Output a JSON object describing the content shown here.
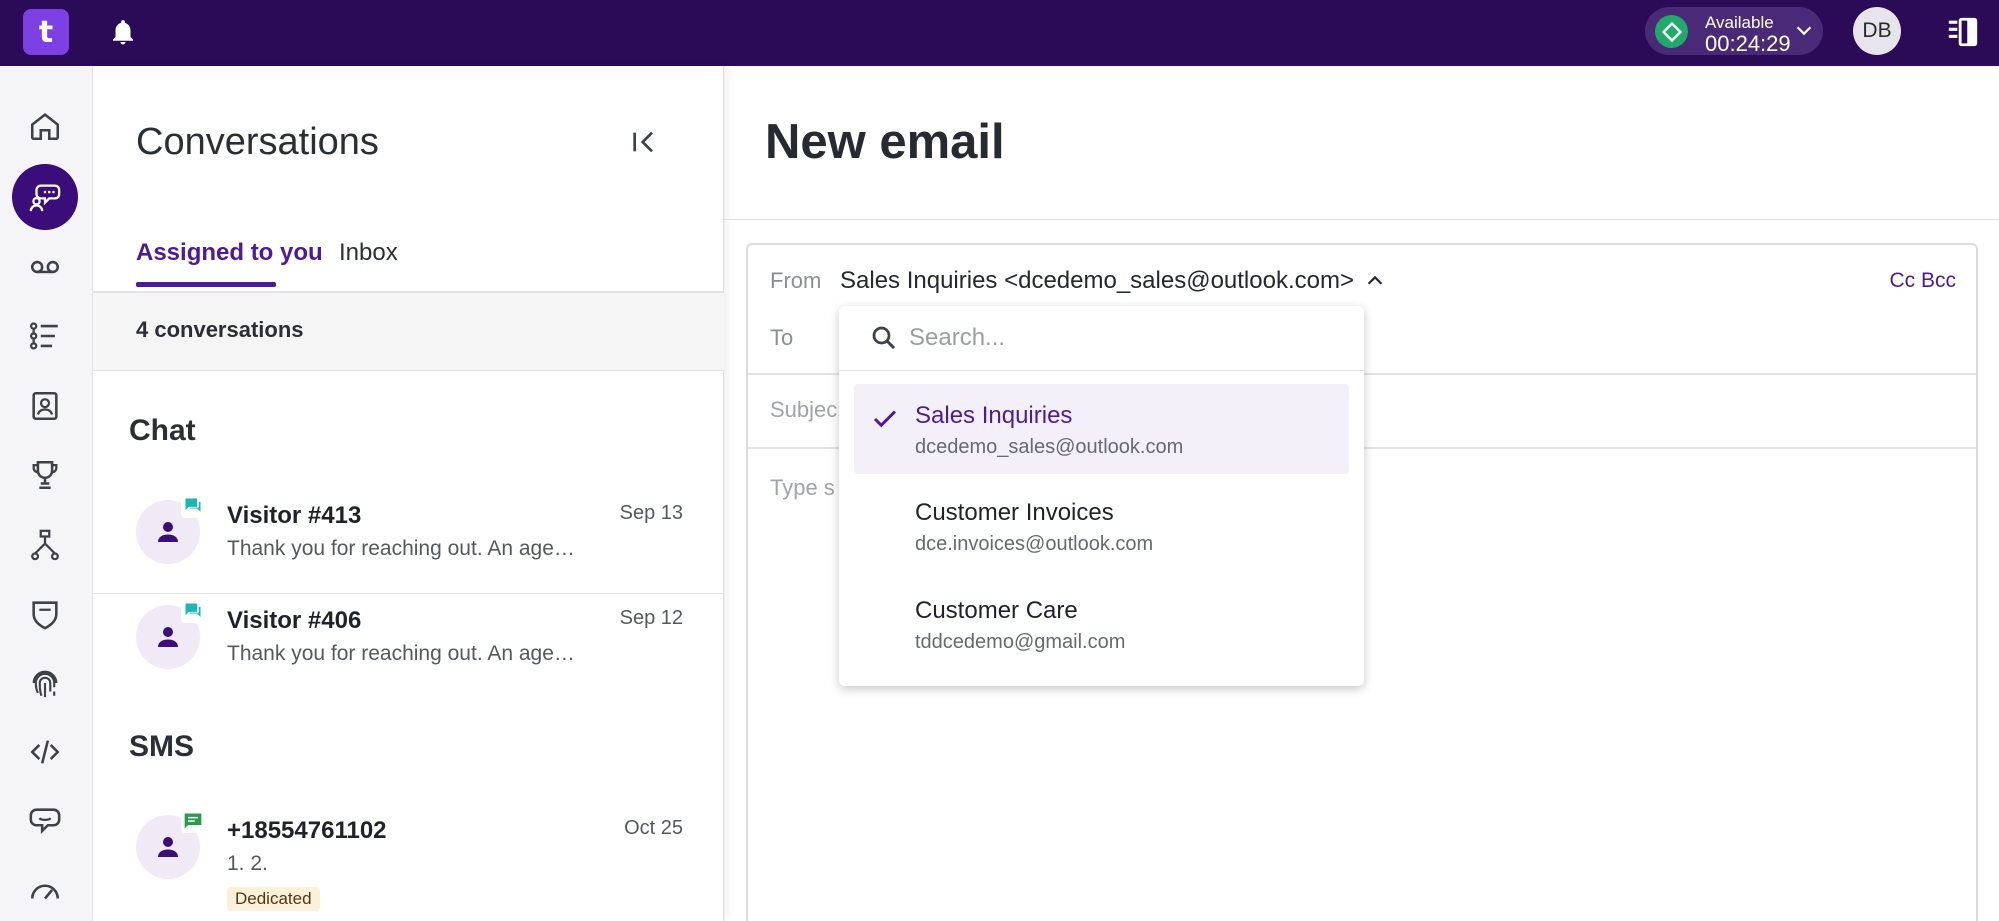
{
  "topbar": {
    "logo_text": "t",
    "status": {
      "label": "Available",
      "timer": "00:24:29",
      "color": "#21a96a"
    },
    "user_initials": "DB",
    "brand_color": "#2b0a57"
  },
  "rail": {
    "items": [
      {
        "icon": "home-icon"
      },
      {
        "icon": "conversations-icon",
        "active": true
      },
      {
        "icon": "voicemail-icon"
      },
      {
        "icon": "tasks-list-icon"
      },
      {
        "icon": "contacts-icon"
      },
      {
        "icon": "trophy-icon"
      },
      {
        "icon": "flow-icon"
      },
      {
        "icon": "shield-icon"
      },
      {
        "icon": "fingerprint-icon"
      },
      {
        "icon": "code-icon"
      },
      {
        "icon": "chatbot-icon"
      },
      {
        "icon": "dashboard-gauge-icon"
      }
    ]
  },
  "conversations": {
    "title": "Conversations",
    "tabs": [
      {
        "label": "Assigned to you",
        "active": true
      },
      {
        "label": "Inbox"
      }
    ],
    "count_label": "4 conversations",
    "sections": [
      {
        "title": "Chat",
        "items": [
          {
            "name": "Visitor #413",
            "preview": "Thank you for reaching out. An age…",
            "date": "Sep 13",
            "channel": "chat"
          },
          {
            "name": "Visitor #406",
            "preview": "Thank you for reaching out. An age…",
            "date": "Sep 12",
            "channel": "chat"
          }
        ]
      },
      {
        "title": "SMS",
        "items": [
          {
            "name": "+18554761102",
            "preview": "1. 2.",
            "date": "Oct 25",
            "channel": "sms",
            "tag": "Dedicated"
          }
        ]
      }
    ]
  },
  "email": {
    "title": "New email",
    "from_label": "From",
    "from_value": "Sales Inquiries <dcedemo_sales@outlook.com>",
    "cc_bcc": "Cc Bcc",
    "to_label": "To",
    "subject_label": "Subjec",
    "body_placeholder": "Type s"
  },
  "from_dropdown": {
    "search_placeholder": "Search...",
    "options": [
      {
        "name": "Sales Inquiries",
        "email": "dcedemo_sales@outlook.com",
        "selected": true
      },
      {
        "name": "Customer Invoices",
        "email": "dce.invoices@outlook.com"
      },
      {
        "name": "Customer Care",
        "email": "tddcedemo@gmail.com"
      }
    ]
  },
  "colors": {
    "accent": "#4b1aa0",
    "chat_badge": "#1fb5b0",
    "sms_badge": "#2a9d4b"
  }
}
